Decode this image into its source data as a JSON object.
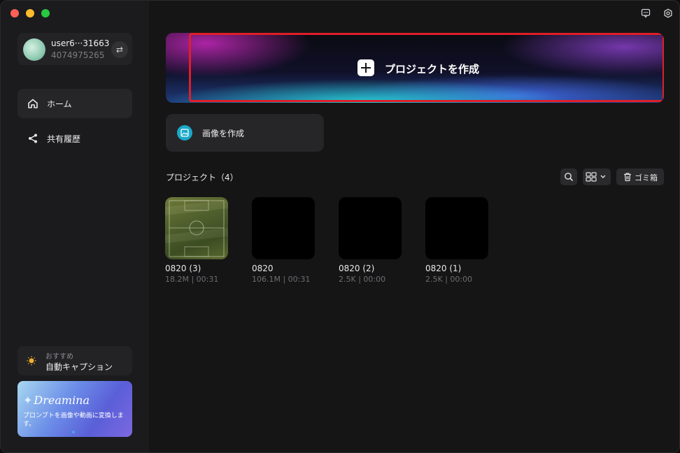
{
  "user": {
    "name": "user6···31663",
    "id": "4074975265"
  },
  "nav": [
    {
      "label": "ホーム",
      "icon": "home-icon",
      "active": true
    },
    {
      "label": "共有履歴",
      "icon": "share-icon",
      "active": false
    }
  ],
  "recommend": {
    "small": "おすすめ",
    "main": "自動キャプション",
    "icon": "lightbulb-icon"
  },
  "promo": {
    "logo": "Dreamina",
    "text": "プロンプトを画像や動画に変換します。"
  },
  "hero": {
    "label": "プロジェクトを作成",
    "highlight_color": "#e01e28"
  },
  "image_create": {
    "label": "画像を作成"
  },
  "projects_section": {
    "title": "プロジェクト（4）"
  },
  "toolbar": {
    "trash_label": "ゴミ箱"
  },
  "projects": [
    {
      "name": "0820 (3)",
      "meta": "18.2M | 00:31",
      "thumb": "soccer-field"
    },
    {
      "name": "0820",
      "meta": "106.1M | 00:31",
      "thumb": "black"
    },
    {
      "name": "0820 (2)",
      "meta": "2.5K | 00:00",
      "thumb": "black"
    },
    {
      "name": "0820 (1)",
      "meta": "2.5K | 00:00",
      "thumb": "black"
    }
  ],
  "colors": {
    "accent": "#1aa9c8",
    "highlight": "#e01e28",
    "background": "#151516",
    "sidebar": "#1b1b1d"
  }
}
